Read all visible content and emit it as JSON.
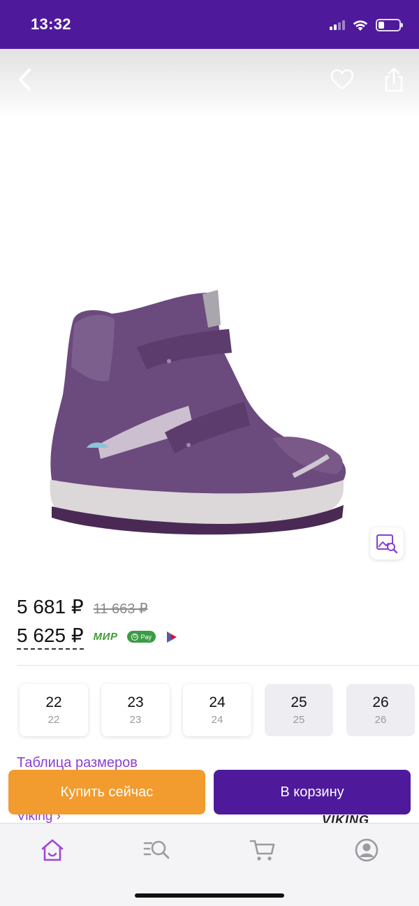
{
  "status_bar": {
    "time": "13:32",
    "background": "#4f199c",
    "battery_level": 0.25
  },
  "header": {
    "back_icon": "chevron-left-icon",
    "favorite_icon": "heart-icon",
    "share_icon": "share-icon"
  },
  "product_image": {
    "subject": "purple-winter-boot",
    "image_search_icon": "image-search-icon"
  },
  "price": {
    "current": "5 681 ₽",
    "old": "11 663 ₽",
    "card_price": "5 625 ₽",
    "payment_logos": {
      "mir": "МИР",
      "gpay": "Pay",
      "sbp": "sbp-icon"
    }
  },
  "sizes": [
    {
      "size": "22",
      "sub": "22",
      "available": true
    },
    {
      "size": "23",
      "sub": "23",
      "available": true
    },
    {
      "size": "24",
      "sub": "24",
      "available": true
    },
    {
      "size": "25",
      "sub": "25",
      "available": false
    },
    {
      "size": "26",
      "sub": "26",
      "available": false
    }
  ],
  "size_table_link": "Таблица размеров",
  "actions": {
    "buy_now": "Купить сейчас",
    "add_to_cart": "В корзину"
  },
  "brand": {
    "link": "Viking ›",
    "logo": "VIKING"
  },
  "bottom_nav": [
    {
      "name": "home",
      "icon": "home-icon",
      "active": true
    },
    {
      "name": "catalog",
      "icon": "catalog-search-icon",
      "active": false
    },
    {
      "name": "cart",
      "icon": "cart-icon",
      "active": false
    },
    {
      "name": "profile",
      "icon": "profile-icon",
      "active": false
    }
  ],
  "colors": {
    "brand_purple": "#4f199c",
    "link_purple": "#8b3fd0",
    "buy_orange": "#f29b2f",
    "nav_active": "#a046d8",
    "nav_inactive": "#9a9aa0"
  }
}
